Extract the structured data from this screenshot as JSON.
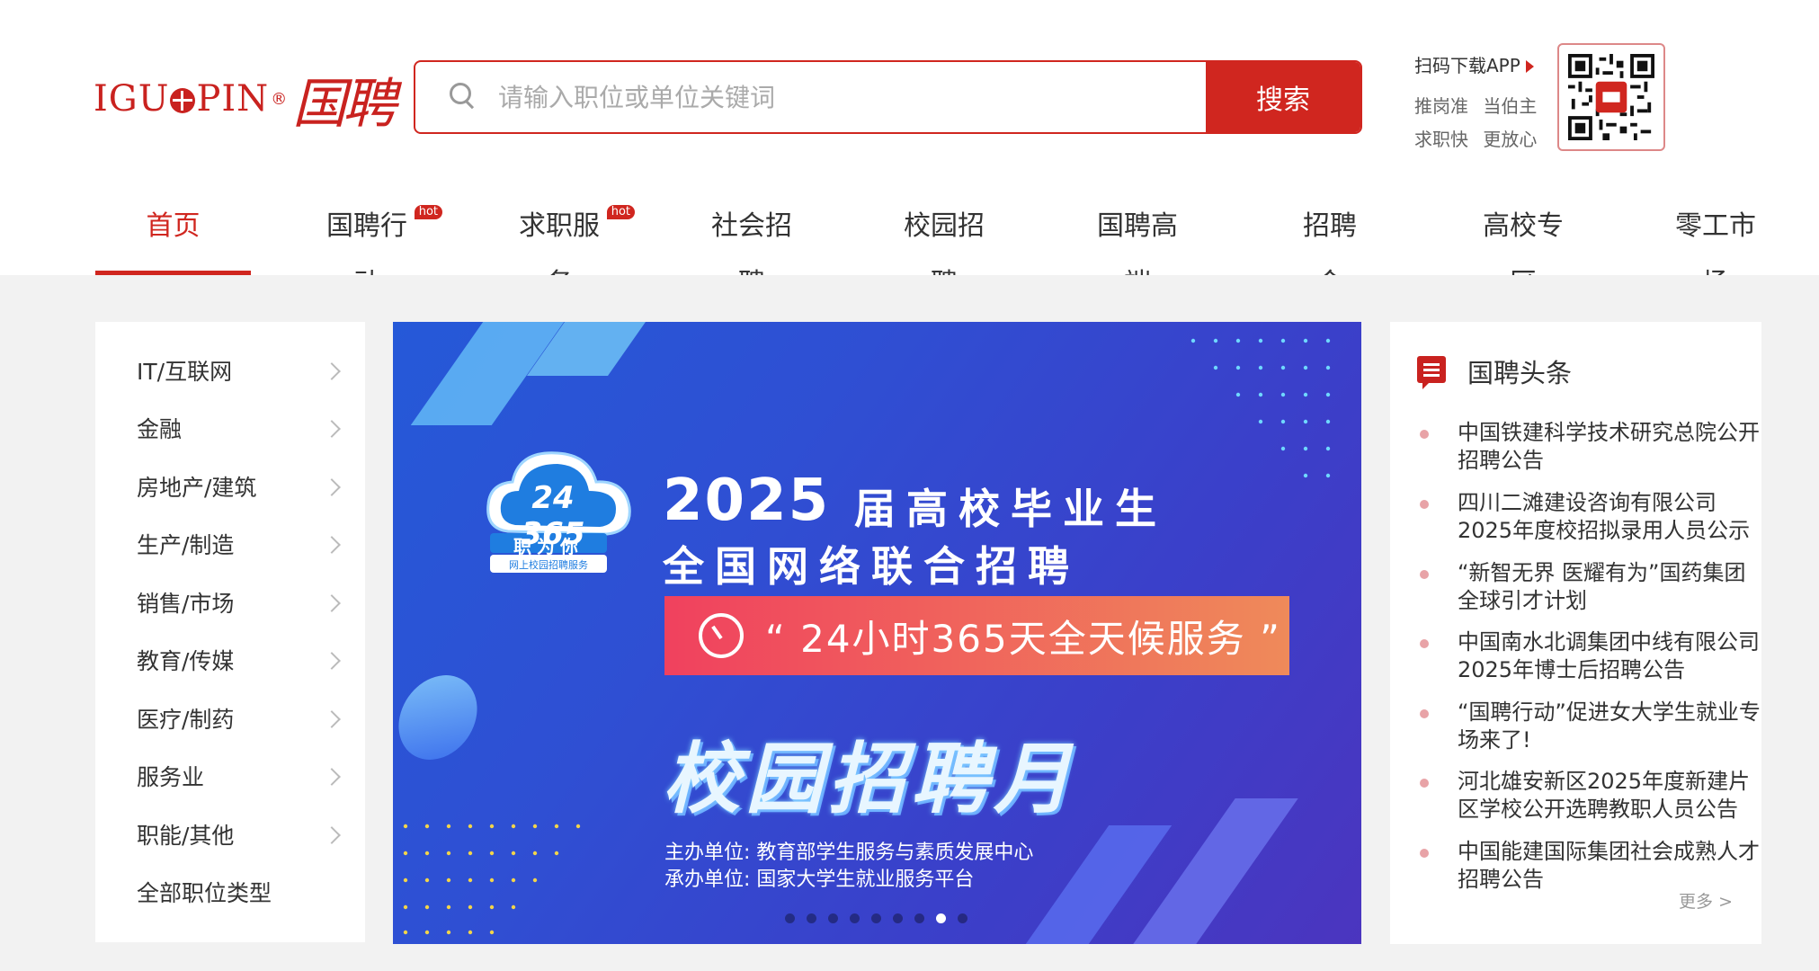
{
  "header": {
    "logo_text": "IGUOPIN",
    "logo_cn": "国聘",
    "search_placeholder": "请输入职位或单位关键词",
    "search_button": "搜索",
    "app_title": "扫码下载APP",
    "app_line1": "推岗准 当伯主",
    "app_line2": "求职快 更放心"
  },
  "nav": {
    "items": [
      {
        "label": "首页",
        "active": true
      },
      {
        "label": "国聘行动",
        "badge": "hot"
      },
      {
        "label": "求职服务",
        "badge": "hot"
      },
      {
        "label": "社会招聘"
      },
      {
        "label": "校园招聘"
      },
      {
        "label": "国聘高端"
      },
      {
        "label": "招聘会"
      },
      {
        "label": "高校专区"
      },
      {
        "label": "零工市场"
      }
    ]
  },
  "categories": [
    "IT/互联网",
    "金融",
    "房地产/建筑",
    "生产/制造",
    "销售/市场",
    "教育/传媒",
    "医疗/制药",
    "服务业",
    "职能/其他",
    "全部职位类型"
  ],
  "banner": {
    "badge_number": "24 365",
    "badge_text": "职为你",
    "badge_sub": "网上校园招聘服务",
    "year": "2025",
    "title_line1": "届高校毕业生",
    "title_line2": "全国网络联合招聘",
    "pill_text": "“ 24小时365天全天候服务 ”",
    "campaign": "校园招聘月",
    "organizer": "主办单位: 教育部学生服务与素质发展中心",
    "co_organizer": "承办单位: 国家大学生就业服务平台",
    "slide_count": 9,
    "active_slide": 8
  },
  "news": {
    "title": "国聘头条",
    "items": [
      "中国铁建科学技术研究总院公开招聘公告",
      "四川二滩建设咨询有限公司2025年度校招拟录用人员公示",
      "“新智无界 医耀有为”国药集团全球引才计划",
      "中国南水北调集团中线有限公司2025年博士后招聘公告",
      "“国聘行动”促进女大学生就业专场来了!",
      "河北雄安新区2025年度新建片区学校公开选聘教职人员公告",
      "中国能建国际集团社会成熟人才招聘公告"
    ],
    "more": "更多 >"
  },
  "colors": {
    "brand_red": "#d0261f",
    "banner_blue": "#2f4fd3"
  }
}
